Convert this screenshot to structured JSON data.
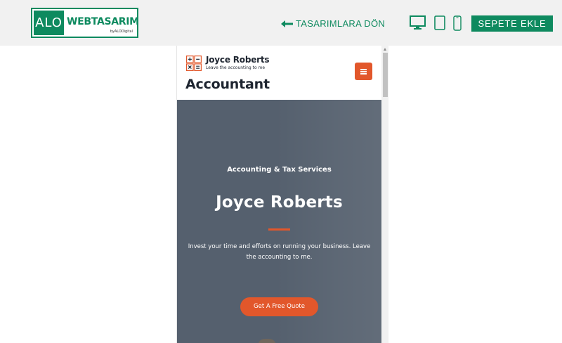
{
  "topbar": {
    "logo": {
      "alo": "ALO",
      "web": "WEBTASARIM",
      "by": "byALODigital"
    },
    "back_link": "TASARIMLARA DÖN",
    "device_icons": [
      "desktop-icon",
      "tablet-icon",
      "mobile-icon"
    ],
    "cart_button": "SEPETE EKLE",
    "colors": {
      "brand": "#0e8a5f",
      "bar": "#f1f1f1"
    }
  },
  "preview": {
    "site_name": "Joyce Roberts",
    "site_tagline": "Leave the accounting to me",
    "site_title": "Accountant",
    "hero": {
      "subtitle": "Accounting & Tax Services",
      "name": "Joyce Roberts",
      "text": "Invest your time and efforts on running your business. Leave the accounting to me.",
      "cta": "Get A Free Quote"
    },
    "colors": {
      "accent": "#e2572b",
      "hero_bg": "#55606e",
      "text_dark": "#1e2530"
    }
  }
}
